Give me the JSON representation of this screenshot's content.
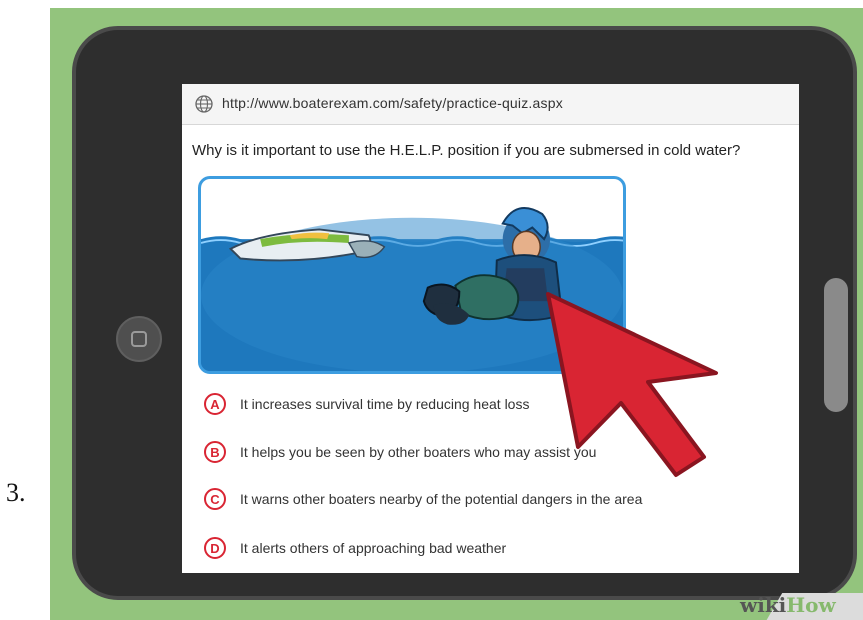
{
  "step": {
    "number": "3."
  },
  "browser": {
    "url": "http://www.boaterexam.com/safety/practice-quiz.aspx",
    "icons": {
      "address": "globe-icon"
    }
  },
  "quiz": {
    "question": "Why is it important to use the H.E.L.P. position if you are submersed in cold water?",
    "image_description_icon": "boat-and-person-in-water-illustration",
    "answers": [
      {
        "letter": "A",
        "text": "It increases survival time by reducing heat loss"
      },
      {
        "letter": "B",
        "text": "It helps you be seen by other boaters who may assist you"
      },
      {
        "letter": "C",
        "text": "It warns other boaters nearby of the potential dangers in the area"
      },
      {
        "letter": "D",
        "text": "It alerts others of approaching bad weather"
      }
    ]
  },
  "overlay": {
    "cursor_icon": "red-arrow-cursor",
    "cursor_color": "#d92533"
  },
  "branding": {
    "logo_wiki": "wiki",
    "logo_how": "How"
  },
  "colors": {
    "background": "#93c47d",
    "tablet": "#2e2e2e",
    "answer_accent": "#d92533",
    "water": "#2a7fc0"
  }
}
